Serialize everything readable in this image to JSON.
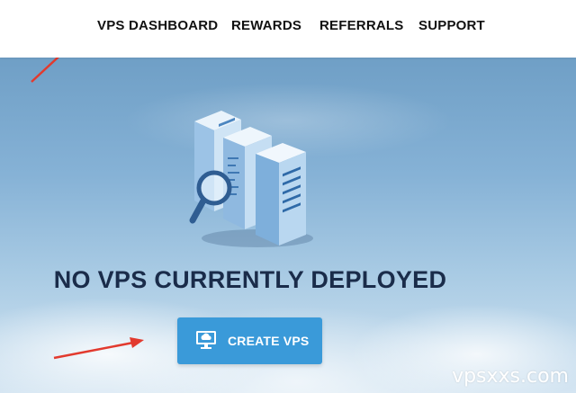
{
  "nav": {
    "items": [
      {
        "label": "VPS DASHBOARD"
      },
      {
        "label": "REWARDS"
      },
      {
        "label": "REFERRALS"
      },
      {
        "label": "SUPPORT"
      }
    ]
  },
  "main": {
    "illustration_icon": "servers-magnifier-icon",
    "heading": "NO VPS CURRENTLY DEPLOYED",
    "create_button": {
      "label": "CREATE VPS",
      "icon": "monitor-cloud-icon"
    }
  },
  "watermark": "vpsxxs.com",
  "annotations": {
    "arrow_color": "#e23a2e"
  },
  "colors": {
    "button": "#3a9ad9",
    "heading": "#1a2c4a",
    "nav_text": "#111111"
  }
}
